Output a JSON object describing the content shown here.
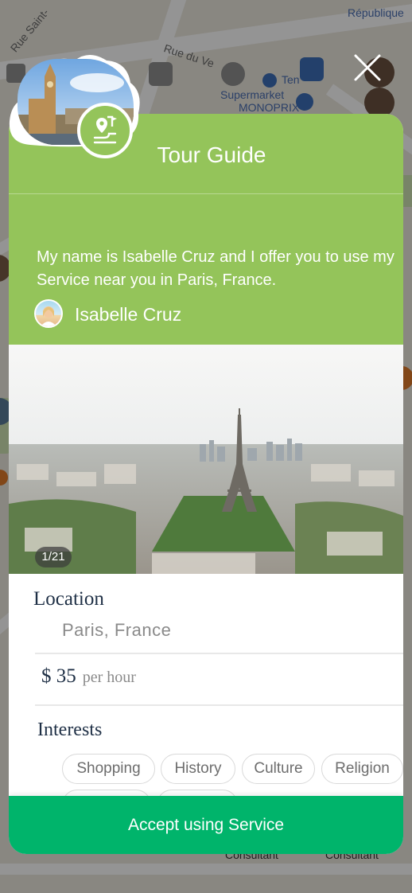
{
  "map": {
    "labels": [
      "République",
      "Rue du Ve",
      "Rue Saint-",
      "Supermarket",
      "MONOPRIX",
      "Ten",
      "Consultant",
      "Consultant"
    ]
  },
  "badge": {
    "photo_icon": "landmark-photo",
    "category_icon": "map-pin-route-icon"
  },
  "card": {
    "title": "Tour Guide",
    "description": "My name is Isabelle Cruz and I offer you to use my Service near you in Paris, France.",
    "owner_name": "Isabelle Cruz",
    "photo_counter": "1/21",
    "location_label": "Location",
    "location_value": "Paris, France",
    "price_value": "$ 35",
    "price_unit": "per hour",
    "interests_label": "Interests",
    "interests": [
      "Shopping",
      "History",
      "Culture",
      "Religion"
    ],
    "accept_button": "Accept using Service"
  },
  "colors": {
    "header_green": "#94c45a",
    "accept_green": "#00b46b",
    "heading_navy": "#1e2f45"
  }
}
